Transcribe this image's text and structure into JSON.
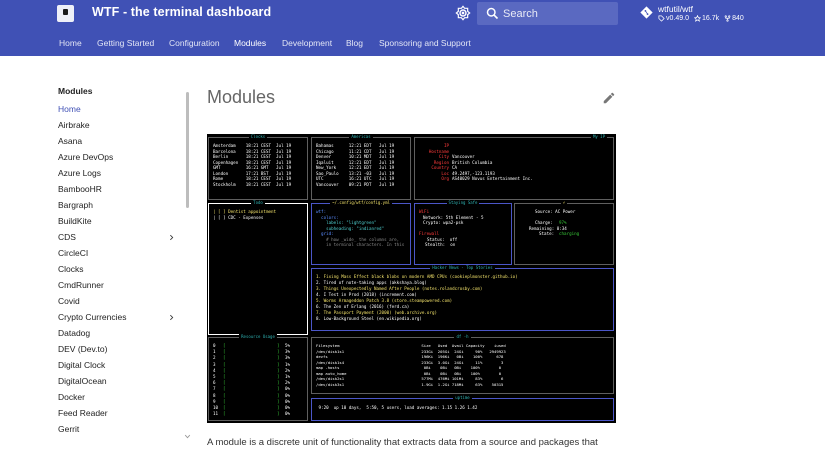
{
  "header": {
    "site_title": "WTF - the terminal dashboard",
    "search_placeholder": "Search",
    "repo": {
      "name": "wtfutil/wtf",
      "version": "v0.49.0",
      "stars": "16.7k",
      "forks": "840"
    }
  },
  "tabs": [
    {
      "label": "Home"
    },
    {
      "label": "Getting Started"
    },
    {
      "label": "Configuration"
    },
    {
      "label": "Modules"
    },
    {
      "label": "Development"
    },
    {
      "label": "Blog"
    },
    {
      "label": "Sponsoring and Support"
    }
  ],
  "sidebar": {
    "title": "Modules",
    "items": [
      {
        "label": "Home"
      },
      {
        "label": "Airbrake"
      },
      {
        "label": "Asana"
      },
      {
        "label": "Azure DevOps"
      },
      {
        "label": "Azure Logs"
      },
      {
        "label": "BambooHR"
      },
      {
        "label": "Bargraph"
      },
      {
        "label": "BuildKite"
      },
      {
        "label": "CDS"
      },
      {
        "label": "CircleCI"
      },
      {
        "label": "Clocks"
      },
      {
        "label": "CmdRunner"
      },
      {
        "label": "Covid"
      },
      {
        "label": "Crypto Currencies"
      },
      {
        "label": "Datadog"
      },
      {
        "label": "DEV (Dev.to)"
      },
      {
        "label": "Digital Clock"
      },
      {
        "label": "DigitalOcean"
      },
      {
        "label": "Docker"
      },
      {
        "label": "Feed Reader"
      },
      {
        "label": "Gerrit"
      }
    ]
  },
  "main": {
    "title": "Modules",
    "intro": "A module is a discrete unit of functionality that extracts data from a source and packages that"
  },
  "terminal": {
    "clocks_left": {
      "title": "Clocks",
      "rows": [
        "Amsterdam    18:21 CEST  Jul 19",
        "Barcelona    18:21 CEST  Jul 19",
        "Berlin       18:21 CEST  Jul 19",
        "Copenhagen   18:21 CEST  Jul 19",
        "GMT          16:21 GMT   Jul 19",
        "London       17:21 BST   Jul 19",
        "Rome         18:21 CEST  Jul 19",
        "Stockholm    18:21 CEST  Jul 19"
      ]
    },
    "clocks_right": {
      "title": "Americas",
      "rows": [
        "Bahamas      12:21 EDT   Jul 19",
        "Chicago      11:21 CDT   Jul 19",
        "Denver       10:21 MDT   Jul 19",
        "Iqaluit      12:21 EDT   Jul 19",
        "New_York     12:21 EDT   Jul 19",
        "Sao_Paulo    13:21 -03   Jul 19",
        "UTC          16:21 UTC   Jul 19",
        "Vancouver    09:21 PDT   Jul 19"
      ]
    },
    "ip": {
      "title": "My IP",
      "rows": [
        {
          "k": "IP",
          "v": ""
        },
        {
          "k": "Hostname",
          "v": ""
        },
        {
          "k": "City",
          "v": "Vancouver"
        },
        {
          "k": "Region",
          "v": "British Columbia"
        },
        {
          "k": "Country",
          "v": "CA"
        },
        {
          "k": "Loc",
          "v": "49.2497,-123.1193"
        },
        {
          "k": "Org",
          "v": "AS40029 Novus Entertainment Inc."
        }
      ]
    },
    "todo": {
      "title": "Todo",
      "rows": [
        "| [ ] Dentist appointment",
        "| [ ] CDC - Expenses"
      ]
    },
    "config": {
      "title": "~/.config/wtf/config.yml",
      "rows": [
        "wtf:",
        "  colors:",
        "    labels: \"lightgreen\"",
        "    subheading: \"indianred\"",
        "  grid:",
        "    # how _wide_ the columns are,",
        "    in terminal characters. In this"
      ]
    },
    "security": {
      "title": "Staying Safe",
      "wifi_label": "WiFi",
      "network": "Network: 5th Element - 5",
      "crypto": "Crypto: wpa2-psk",
      "firewall_label": "Firewall",
      "status": "Status:  off",
      "stealth": "Stealth:  on"
    },
    "power": {
      "title": "⚡",
      "source": "Source: AC Power",
      "charge_label": "Charge:",
      "charge_value": "97%",
      "remaining": "Remaining: 0:34",
      "state_label": "State:",
      "state_value": "charging"
    },
    "hackernews": {
      "title": "Hacker News - Top Stories",
      "rows": [
        "1. Fixing Mass Effect black blobs on modern AMD CPUs (cookieplmonster.github.io)",
        "2. Tired of note-taking apps (akkshaya.blog)",
        "3. Things Unexpectedly Named After People (notes.rolandcrosby.com)",
        "4. I Test in Prod (2018) (increment.com)",
        "5. Worms Armageddon Patch 3.8 (store.steampowered.com)",
        "6. The Zen of Erlang (2016) (ferd.ca)",
        "7. The Passport Payment (2000) (web.archive.org)",
        "8. Low-Background Steel (en.wikipedia.org)"
      ]
    },
    "resources": {
      "title": "Resource Usage",
      "rows": [
        {
          "n": "0",
          "pct": "5%"
        },
        {
          "n": "1",
          "pct": "3%"
        },
        {
          "n": "2",
          "pct": "3%"
        },
        {
          "n": "3",
          "pct": "1%"
        },
        {
          "n": "4",
          "pct": "2%"
        },
        {
          "n": "5",
          "pct": "1%"
        },
        {
          "n": "6",
          "pct": "2%"
        },
        {
          "n": "7",
          "pct": "0%"
        },
        {
          "n": "8",
          "pct": "0%"
        },
        {
          "n": "9",
          "pct": "0%"
        },
        {
          "n": "10",
          "pct": "0%"
        },
        {
          "n": "11",
          "pct": "0%"
        }
      ]
    },
    "df": {
      "title": "df -h",
      "header": "Filesystem                                   Size   Used  Avail Capacity    iused",
      "rows": [
        "/dev/disk1s1                                 233Gi  205Gi  24Gi     90%   2949923",
        "devfs                                        196Ki  196Ki   0Bi    100%      678",
        "/dev/disk1s4                                 233Gi  3.0Gi  24Gi     11%        3",
        "map -hosts                                    0Bi    0Bi   0Bi    100%        0",
        "map auto_home                                 0Bi    0Bi   0Bi    100%        0",
        "/dev/disk2s1                                 577Mi  476Mi 101Mi     83%        6",
        "/dev/disk3s1                                 1.9Gi  1.2Gi 718Mi     63%    50315"
      ]
    },
    "uptime": {
      "title": "uptime",
      "line": " 9:20  up 10 days,  5:50, 5 users, load averages: 1.15 1.26 1.42"
    }
  }
}
